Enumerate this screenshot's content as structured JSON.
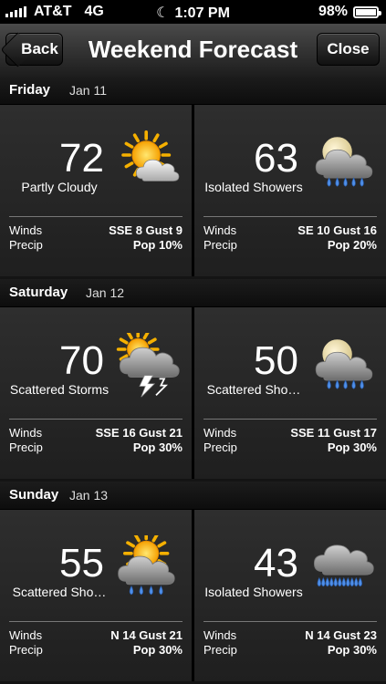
{
  "status_bar": {
    "carrier": "AT&T",
    "network": "4G",
    "time": "1:07 PM",
    "battery": "98%",
    "battery_level": 0.98
  },
  "nav": {
    "back_label": "Back",
    "title": "Weekend Forecast",
    "close_label": "Close"
  },
  "days": [
    {
      "name": "Friday",
      "date": "Jan 11",
      "day": {
        "temp": "72",
        "condition": "Partly Cloudy",
        "icon": "partly-cloudy-icon",
        "winds": "SSE 8 Gust 9",
        "precip": "Pop 10%"
      },
      "night": {
        "temp": "63",
        "condition": "Isolated Showers",
        "icon": "night-showers-icon",
        "winds": "SE 10 Gust 16",
        "precip": "Pop 20%"
      }
    },
    {
      "name": "Saturday",
      "date": "Jan 12",
      "day": {
        "temp": "70",
        "condition": "Scattered Storms",
        "icon": "thunderstorm-icon",
        "winds": "SSE 16 Gust 21",
        "precip": "Pop 30%"
      },
      "night": {
        "temp": "50",
        "condition": "Scattered Sho…",
        "icon": "night-showers-icon",
        "winds": "SSE 11 Gust 17",
        "precip": "Pop 30%"
      }
    },
    {
      "name": "Sunday",
      "date": "Jan 13",
      "day": {
        "temp": "55",
        "condition": "Scattered Sho…",
        "icon": "sun-showers-icon",
        "winds": "N 14 Gust 21",
        "precip": "Pop 30%"
      },
      "night": {
        "temp": "43",
        "condition": "Isolated Showers",
        "icon": "heavy-rain-icon",
        "winds": "N 14 Gust 23",
        "precip": "Pop 30%"
      }
    }
  ],
  "labels": {
    "winds": "Winds",
    "precip": "Precip"
  }
}
